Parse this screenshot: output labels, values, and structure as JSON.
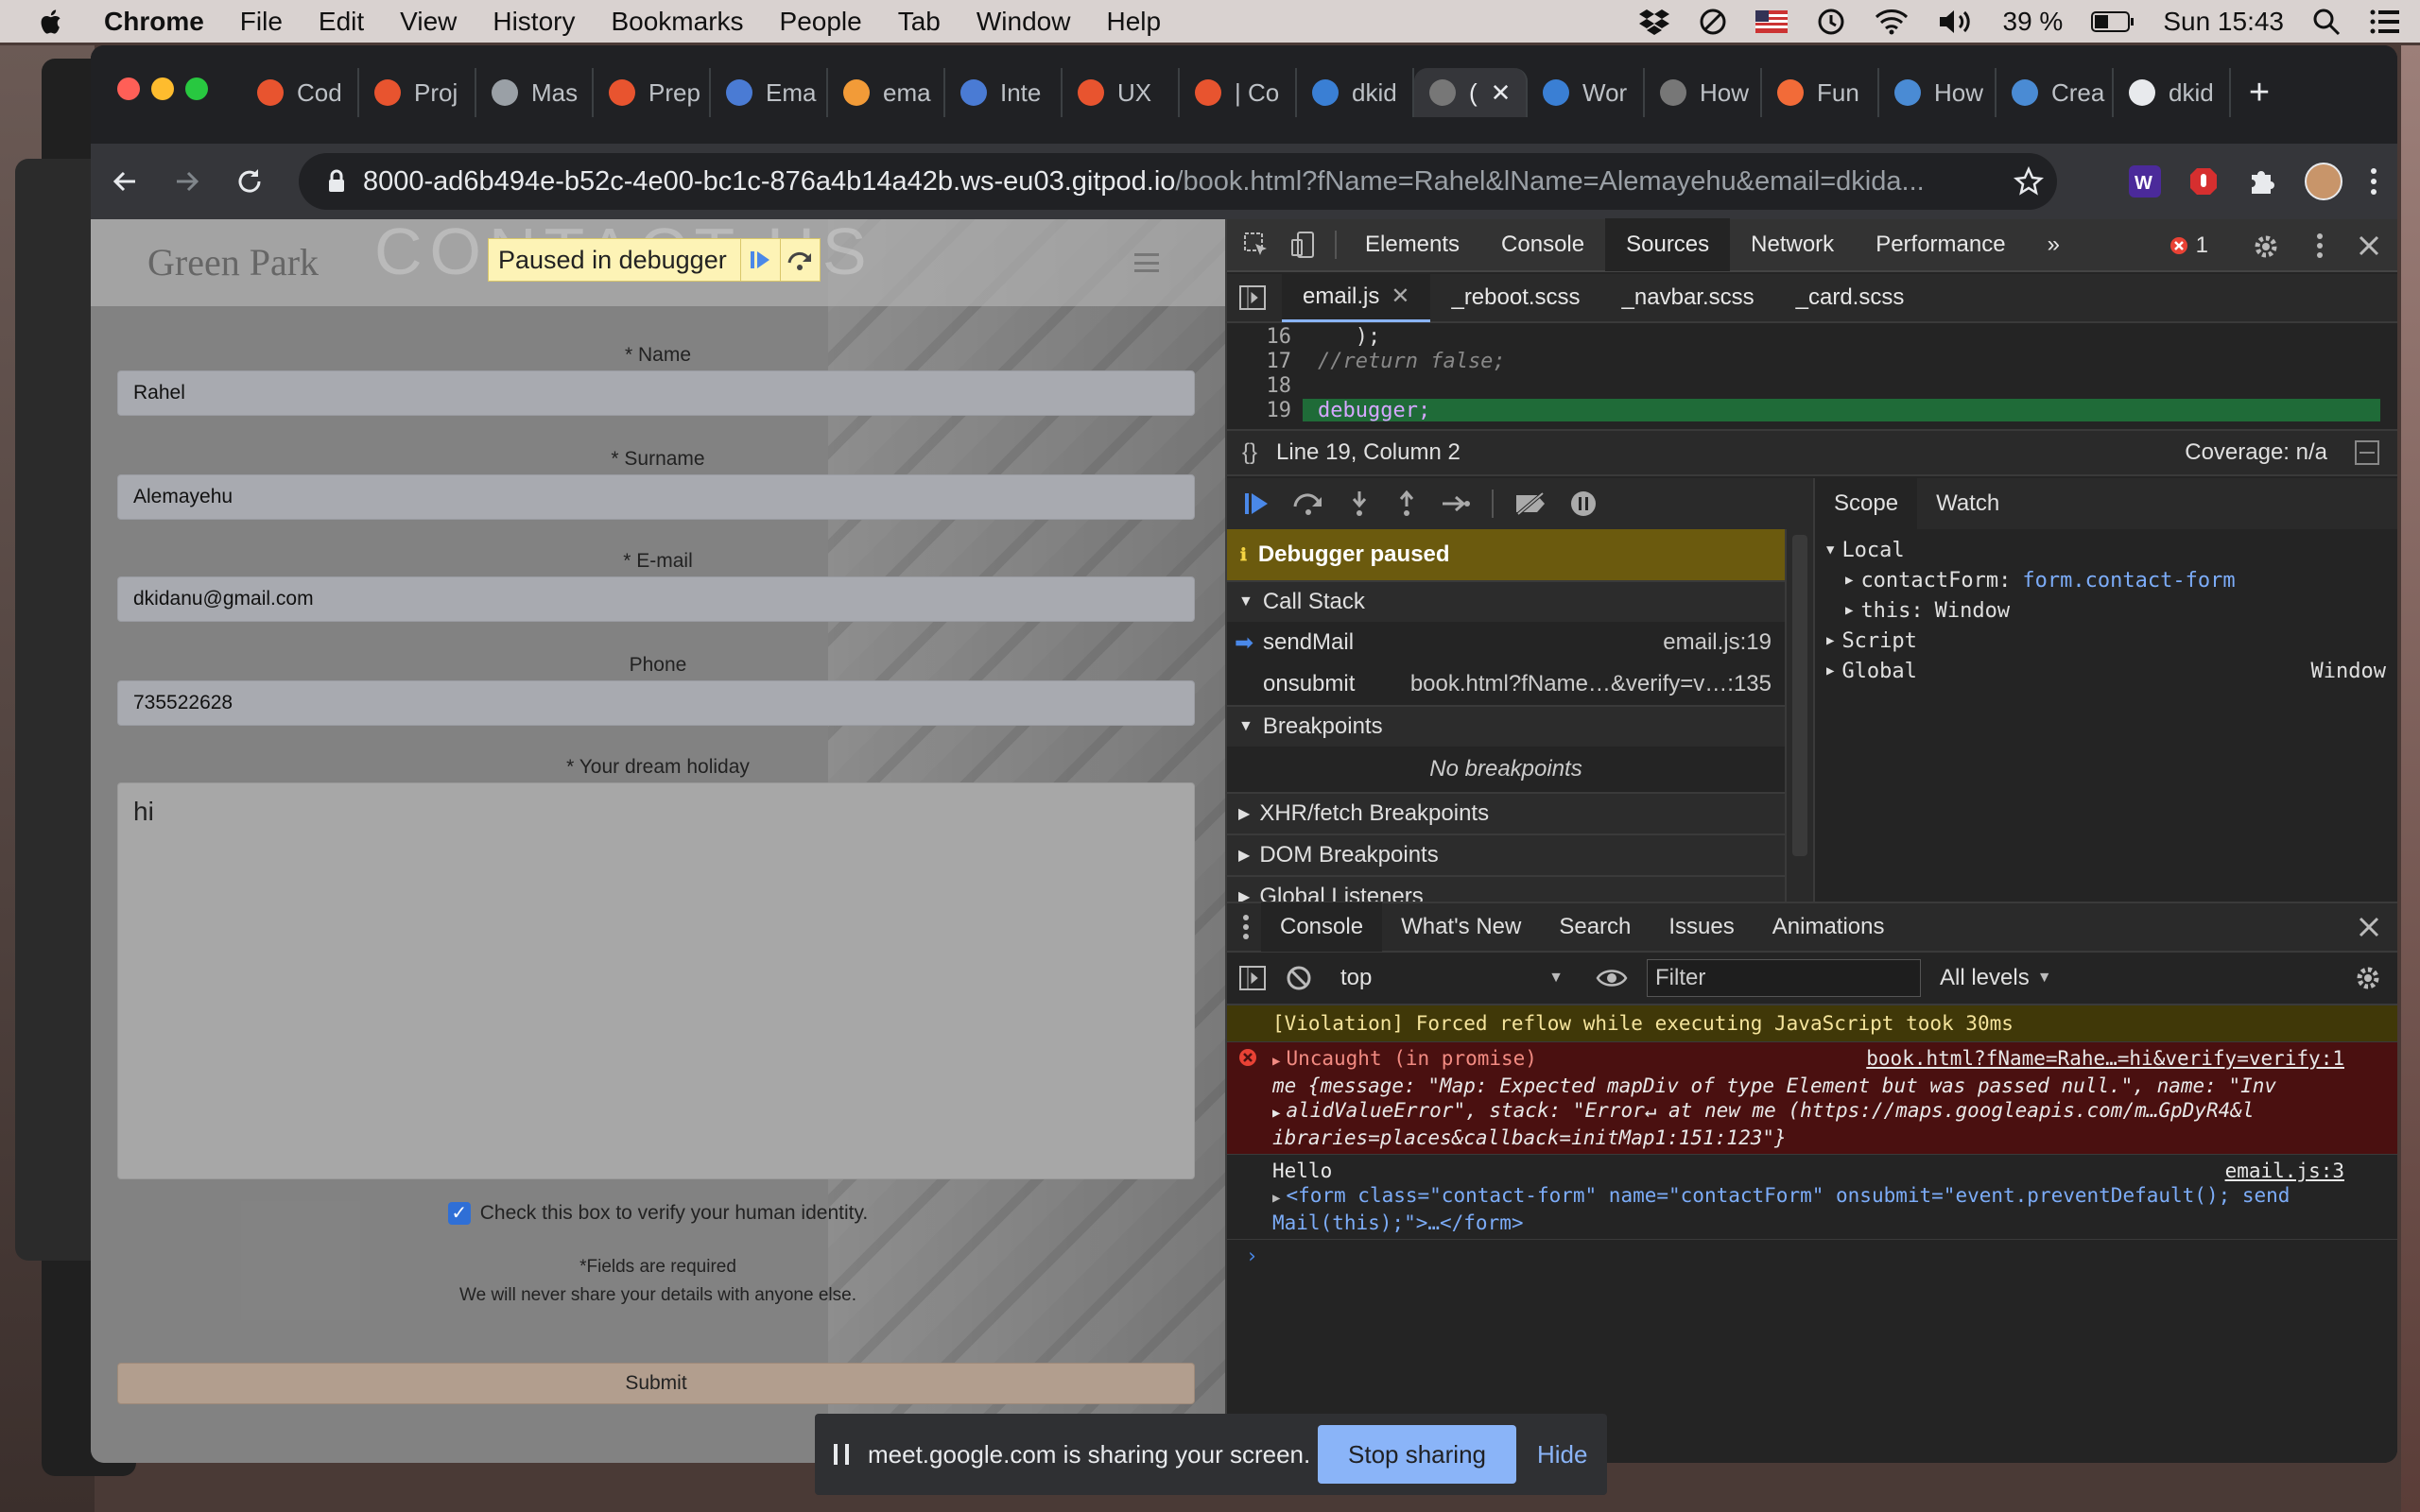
{
  "menubar": {
    "app": "Chrome",
    "items": [
      "File",
      "Edit",
      "View",
      "History",
      "Bookmarks",
      "People",
      "Tab",
      "Window",
      "Help"
    ],
    "battery": "39 %",
    "clock": "Sun 15:43"
  },
  "tabs": [
    {
      "label": "Cod",
      "color": "#e8542f"
    },
    {
      "label": "Proj",
      "color": "#e8542f"
    },
    {
      "label": "Mas",
      "color": "#9aa0a6"
    },
    {
      "label": "Prep",
      "color": "#e8542f"
    },
    {
      "label": "Ema",
      "color": "#4a7bd4"
    },
    {
      "label": "ema",
      "color": "#f29b38"
    },
    {
      "label": "Inte",
      "color": "#4a7bd4"
    },
    {
      "label": "UX",
      "color": "#e8542f"
    },
    {
      "label": "| Co",
      "color": "#e8542f"
    },
    {
      "label": "dkid",
      "color": "#3a7fd4"
    },
    {
      "label": "(",
      "color": "#777"
    },
    {
      "label": "Wor",
      "color": "#3a7fd4"
    },
    {
      "label": "How",
      "color": "#777"
    },
    {
      "label": "Fun",
      "color": "#f26b38"
    },
    {
      "label": "How",
      "color": "#4a8bd4"
    },
    {
      "label": "Crea",
      "color": "#4a8bd4"
    },
    {
      "label": "dkid",
      "color": "#e8eaed"
    }
  ],
  "address": {
    "host": "8000-ad6b494e-b52c-4e00-bc1c-876a4b14a42b.ws-eu03.gitpod.io",
    "path": "/book.html?fName=Rahel&lName=Alemayehu&email=dkida..."
  },
  "page": {
    "brand": "Green Park",
    "paused_label": "Paused in debugger",
    "form": {
      "name_label": "* Name",
      "name_value": "Rahel",
      "surname_label": "* Surname",
      "surname_value": "Alemayehu",
      "email_label": "* E-mail",
      "email_value": "dkidanu@gmail.com",
      "phone_label": "Phone",
      "phone_value": "735522628",
      "holiday_label": "* Your dream holiday",
      "holiday_value": "hi",
      "verify_label": "Check this box to verify your human identity.",
      "note_required": "*Fields are required",
      "note_privacy": "We will never share your details with anyone else.",
      "submit_label": "Submit"
    }
  },
  "devtools": {
    "tabs": [
      "Elements",
      "Console",
      "Sources",
      "Network",
      "Performance"
    ],
    "error_count": "1",
    "files": [
      "email.js",
      "_reboot.scss",
      "_navbar.scss",
      "_card.scss"
    ],
    "code": [
      {
        "num": "16",
        "text": "   );"
      },
      {
        "num": "17",
        "text": "//return false;"
      },
      {
        "num": "18",
        "text": ""
      },
      {
        "num": "19",
        "text": "debugger;"
      }
    ],
    "cursor": "Line 19, Column 2",
    "coverage": "Coverage: n/a",
    "paused_banner": "Debugger paused",
    "call_stack_title": "Call Stack",
    "frames": [
      {
        "fn": "sendMail",
        "loc": "email.js:19"
      },
      {
        "fn": "onsubmit",
        "loc": "book.html?fName…&verify=v…:135"
      }
    ],
    "breakpoints_title": "Breakpoints",
    "no_breakpoints": "No breakpoints",
    "xhr_title": "XHR/fetch Breakpoints",
    "dom_title": "DOM Breakpoints",
    "global_title": "Global Listeners",
    "scope_tabs": [
      "Scope",
      "Watch"
    ],
    "scope": {
      "local": "Local",
      "contact_key": "contactForm:",
      "contact_val": "form.contact-form",
      "this_key": "this:",
      "this_val": "Window",
      "script": "Script",
      "global": "Global",
      "global_val": "Window"
    },
    "drawer_tabs": [
      "Console",
      "What's New",
      "Search",
      "Issues",
      "Animations"
    ],
    "context": "top",
    "filter_placeholder": "Filter",
    "levels": "All levels",
    "messages": {
      "violation": "[Violation] Forced reflow while executing JavaScript took 30ms",
      "error_head": "Uncaught (in promise)",
      "error_src": "book.html?fName=Rahe…=hi&verify=verify:1",
      "error_line1": "me {message: \"Map: Expected mapDiv of type Element but was passed null.\", name: \"Inv",
      "error_line2": "alidValueError\", stack: \"Error↵    at new me (https://maps.googleapis.com/m…GpDyR4&l",
      "error_line3": "ibraries=places&callback=initMap1:151:123\"}",
      "log_text": "Hello",
      "log_src": "email.js:3",
      "log_line1": "<form class=\"contact-form\" name=\"contactForm\" onsubmit=\"event.preventDefault(); send",
      "log_line2": "Mail(this);\">…</form>"
    }
  },
  "share_bar": {
    "text": "meet.google.com is sharing your screen.",
    "stop": "Stop sharing",
    "hide": "Hide"
  }
}
